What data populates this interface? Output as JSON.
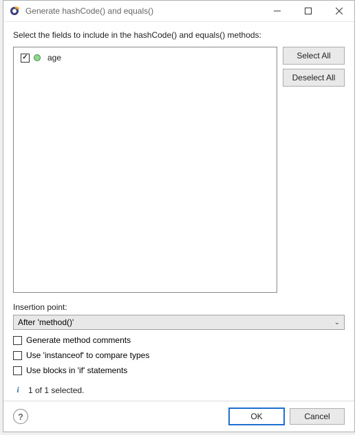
{
  "window": {
    "title": "Generate hashCode() and equals()"
  },
  "dialog": {
    "instruction": "Select the fields to include in the hashCode() and equals() methods:",
    "fields": [
      {
        "name": "age",
        "checked": true
      }
    ],
    "buttons": {
      "select_all": "Select All",
      "deselect_all": "Deselect All"
    },
    "insertion_point_label": "Insertion point:",
    "insertion_point_value": "After 'method()'",
    "options": {
      "generate_comments": {
        "label": "Generate method comments",
        "checked": false
      },
      "use_instanceof": {
        "label": "Use 'instanceof' to compare types",
        "checked": false
      },
      "use_blocks": {
        "label": "Use blocks in 'if' statements",
        "checked": false
      }
    },
    "status": "1 of 1 selected."
  },
  "footer": {
    "ok": "OK",
    "cancel": "Cancel"
  }
}
